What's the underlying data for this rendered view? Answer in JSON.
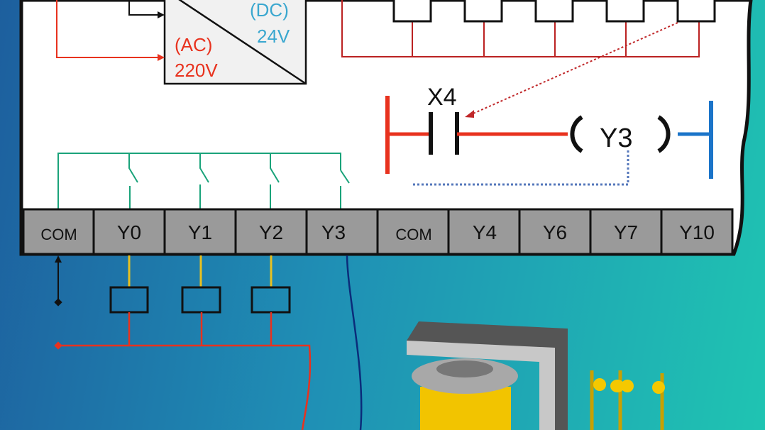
{
  "power_supply": {
    "dc_label": "(DC)",
    "dc_voltage": "24V",
    "ac_label": "(AC)",
    "ac_voltage": "220V"
  },
  "ladder": {
    "contact_label": "X4",
    "coil_label": "Y3"
  },
  "terminals": [
    "COM",
    "Y0",
    "Y1",
    "Y2",
    "Y3",
    "COM",
    "Y4",
    "Y6",
    "Y7",
    "Y10"
  ],
  "colors": {
    "ac_wire": "#e8321e",
    "dc_text": "#3aa7cf",
    "output_wire": "#1aa37a",
    "coil_wire": "#e8c020",
    "ladder_right_rail": "#1b74c9",
    "terminal_strip": "#9a9a9a"
  }
}
